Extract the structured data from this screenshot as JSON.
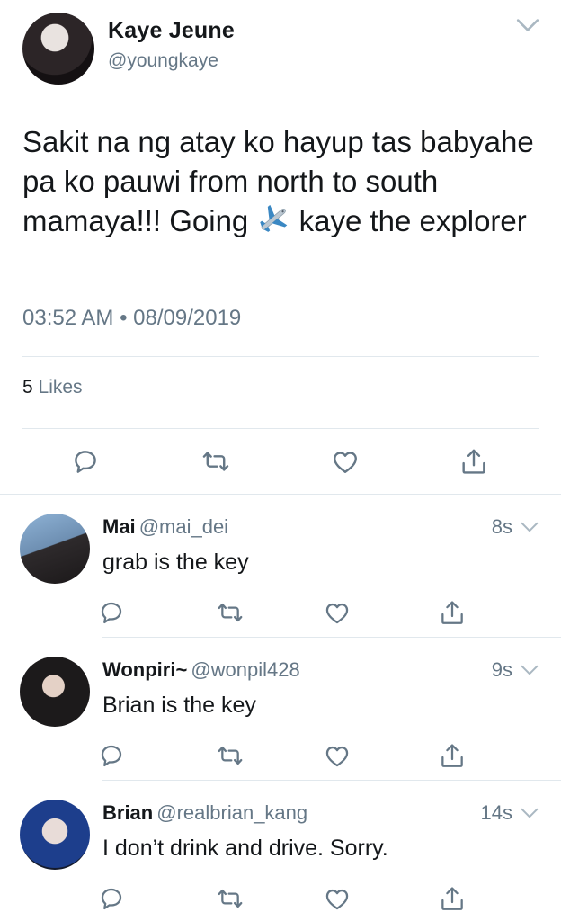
{
  "main_tweet": {
    "name": "Kaye Jeune",
    "handle": "@youngkaye",
    "text_before_icon": "Sakit na ng atay ko hayup tas babyahe pa ko pauwi from north to south mamaya!!! Going ",
    "inline_icon": "airplane-emoji",
    "text_after_icon": " kaye the explorer",
    "timestamp": "03:52 AM • 08/09/2019",
    "likes_count": "5",
    "likes_label": " Likes"
  },
  "replies": [
    {
      "name": "Mai",
      "handle": "@mai_dei",
      "time": "8s",
      "text": "grab is the key"
    },
    {
      "name": "Wonpiri~",
      "handle": "@wonpil428",
      "time": "9s",
      "text": "Brian is the key"
    },
    {
      "name": "Brian",
      "handle": "@realbrian_kang",
      "time": "14s",
      "text": "I don’t drink and drive. Sorry."
    }
  ],
  "icons": [
    "reply-icon",
    "retweet-icon",
    "like-icon",
    "share-icon",
    "chevron-down-icon"
  ],
  "colors": {
    "text": "#14171a",
    "secondary": "#657786",
    "divider": "#e1e8ed",
    "icon": "#657786"
  }
}
